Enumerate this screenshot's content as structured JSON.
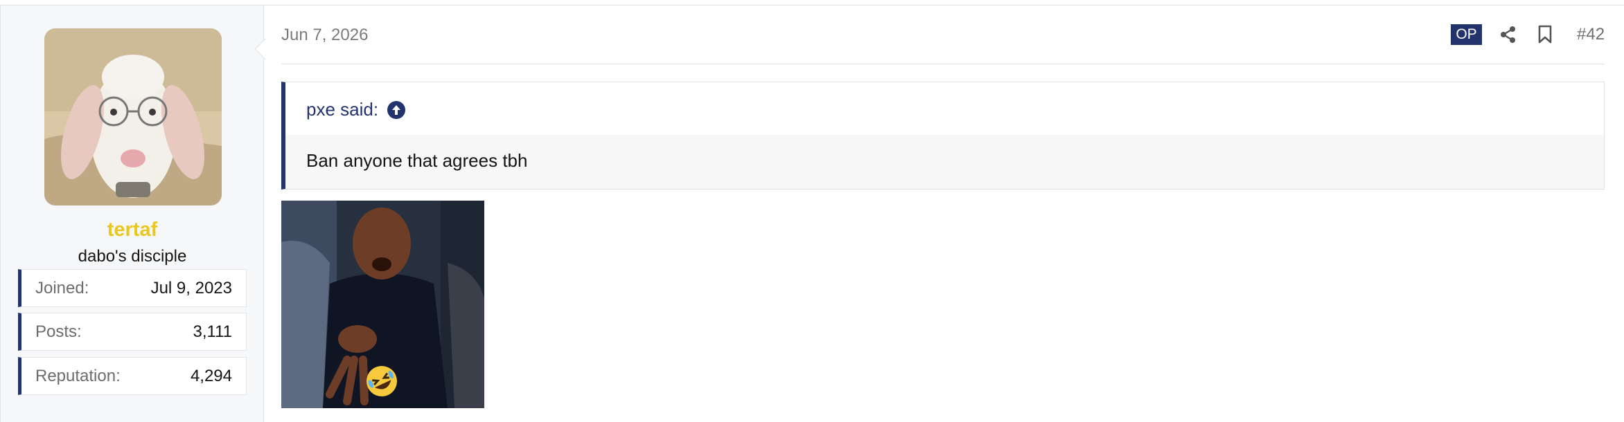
{
  "user": {
    "username": "tertaf",
    "title": "dabo's disciple",
    "avatar_icon": "goat-with-glasses-avatar",
    "stats": [
      {
        "label": "Joined:",
        "value": "Jul 9, 2023"
      },
      {
        "label": "Posts:",
        "value": "3,111"
      },
      {
        "label": "Reputation:",
        "value": "4,294"
      }
    ]
  },
  "post": {
    "date": "Jun 7, 2026",
    "op_badge": "OP",
    "share_icon": "share-icon",
    "bookmark_icon": "bookmark-icon",
    "number": "#42",
    "quote": {
      "author_label": "pxe said:",
      "jump_icon": "arrow-up-circle-icon",
      "text": "Ban anyone that agrees tbh"
    },
    "attachment_icon": "reaction-gif-laughing-man",
    "emoji_icon": "rolling-on-floor-laughing-emoji"
  },
  "colors": {
    "accent": "#23336e",
    "username": "#e8c81f",
    "sidebar_bg": "#f6f7f9"
  }
}
